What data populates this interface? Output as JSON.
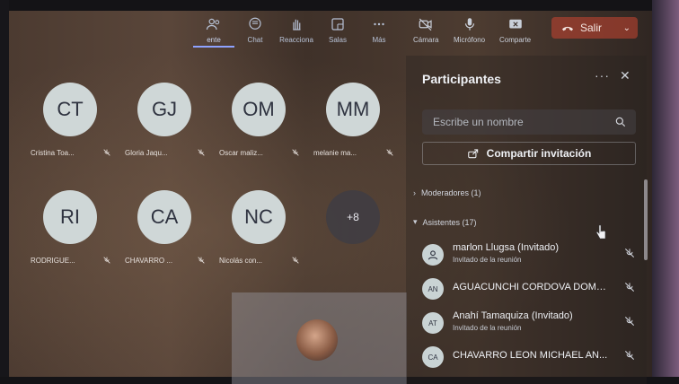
{
  "toolbar": {
    "items": [
      {
        "label": "ente"
      },
      {
        "label": "Chat"
      },
      {
        "label": "Reacciona"
      },
      {
        "label": "Salas"
      },
      {
        "label": "Más"
      }
    ]
  },
  "controls": {
    "camera": "Cámara",
    "mic": "Micrófono",
    "share": "Comparte",
    "leave": "Salir"
  },
  "grid": {
    "tiles": [
      {
        "initials": "CT",
        "name": "Cristina Toa..."
      },
      {
        "initials": "GJ",
        "name": "Gloria Jaqu..."
      },
      {
        "initials": "OM",
        "name": "Oscar maliz..."
      },
      {
        "initials": "MM",
        "name": "melanie ma..."
      },
      {
        "initials": "RI",
        "name": "RODRIGUE..."
      },
      {
        "initials": "CA",
        "name": "CHAVARRO ..."
      },
      {
        "initials": "NC",
        "name": "Nicolás con..."
      },
      {
        "initials": "+8",
        "name": ""
      }
    ]
  },
  "panel": {
    "title": "Participantes",
    "search_placeholder": "Escribe un nombre",
    "share_invite": "Compartir invitación",
    "sections": {
      "moderators": "Moderadores (1)",
      "attendees": "Asistentes (17)"
    },
    "participants": [
      {
        "initials": "",
        "name": "marlon Llugsa (Invitado)",
        "subtitle": "Invitado de la reunión"
      },
      {
        "initials": "AN",
        "name": "AGUACUNCHI CORDOVA DOME...",
        "subtitle": ""
      },
      {
        "initials": "AT",
        "name": "Anahí Tamaquiza (Invitado)",
        "subtitle": "Invitado de la reunión"
      },
      {
        "initials": "CA",
        "name": "CHAVARRO LEON MICHAEL AN...",
        "subtitle": ""
      }
    ]
  },
  "colors": {
    "accent": "#8ea2ff",
    "leave": "#c84632",
    "avatar": "#cfd7d7"
  }
}
